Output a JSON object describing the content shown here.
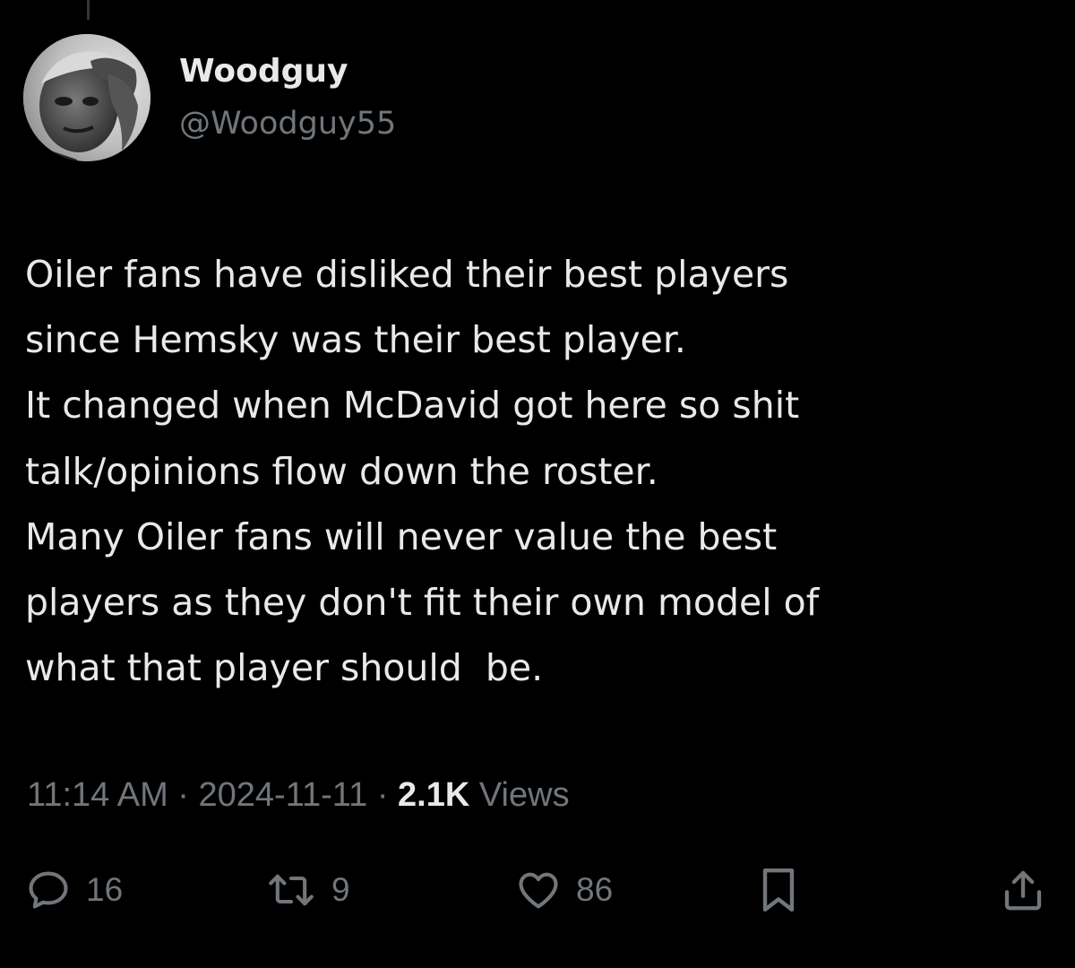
{
  "user": {
    "display_name": "Woodguy",
    "handle": "@Woodguy55"
  },
  "tweet": {
    "lines": [
      "Oiler fans have disliked their best players",
      "since Hemsky was their best player.",
      "It changed when McDavid got here so shit",
      "talk/opinions flow down the roster.",
      "Many Oiler fans will never value the best",
      "players as they don't fit their own model of",
      "what that player should  be."
    ]
  },
  "meta": {
    "time": "11:14 AM",
    "separator": " · ",
    "date": "2024-11-11",
    "views_count": "2.1K",
    "views_label": " Views"
  },
  "actions": {
    "reply_icon": "reply-icon",
    "reply_count": "16",
    "repost_icon": "repost-icon",
    "repost_count": "9",
    "like_icon": "heart-icon",
    "like_count": "86",
    "bookmark_icon": "bookmark-icon",
    "share_icon": "share-icon"
  },
  "colors": {
    "background": "#000000",
    "text_primary": "#e7e9ea",
    "text_secondary": "#71767b"
  }
}
